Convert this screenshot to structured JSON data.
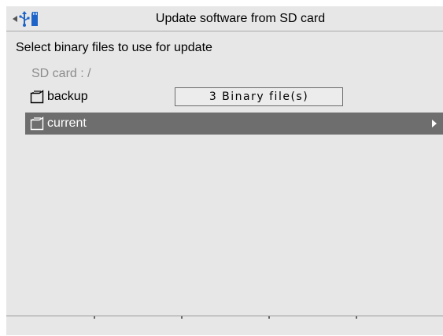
{
  "title_bar": {
    "title": "Update software from SD card",
    "icons": [
      "back-arrow-icon",
      "usb-icon",
      "sd-card-icon"
    ]
  },
  "subtitle": "Select binary files to use for update",
  "path": "SD card : /",
  "entries": [
    {
      "name": "backup",
      "icon": "folder-icon",
      "info": "3 Binary file(s)",
      "selected": false
    },
    {
      "name": "current",
      "icon": "folder-icon",
      "info": "",
      "selected": true
    }
  ],
  "softkeys": [
    "",
    "",
    "",
    "",
    ""
  ],
  "colors": {
    "background": "#e7e7e7",
    "selected_row": "#6e6e6e",
    "path_text": "#8c8c8c",
    "sd_card_icon": "#1e64c8",
    "usb_icon": "#1e64c8"
  }
}
